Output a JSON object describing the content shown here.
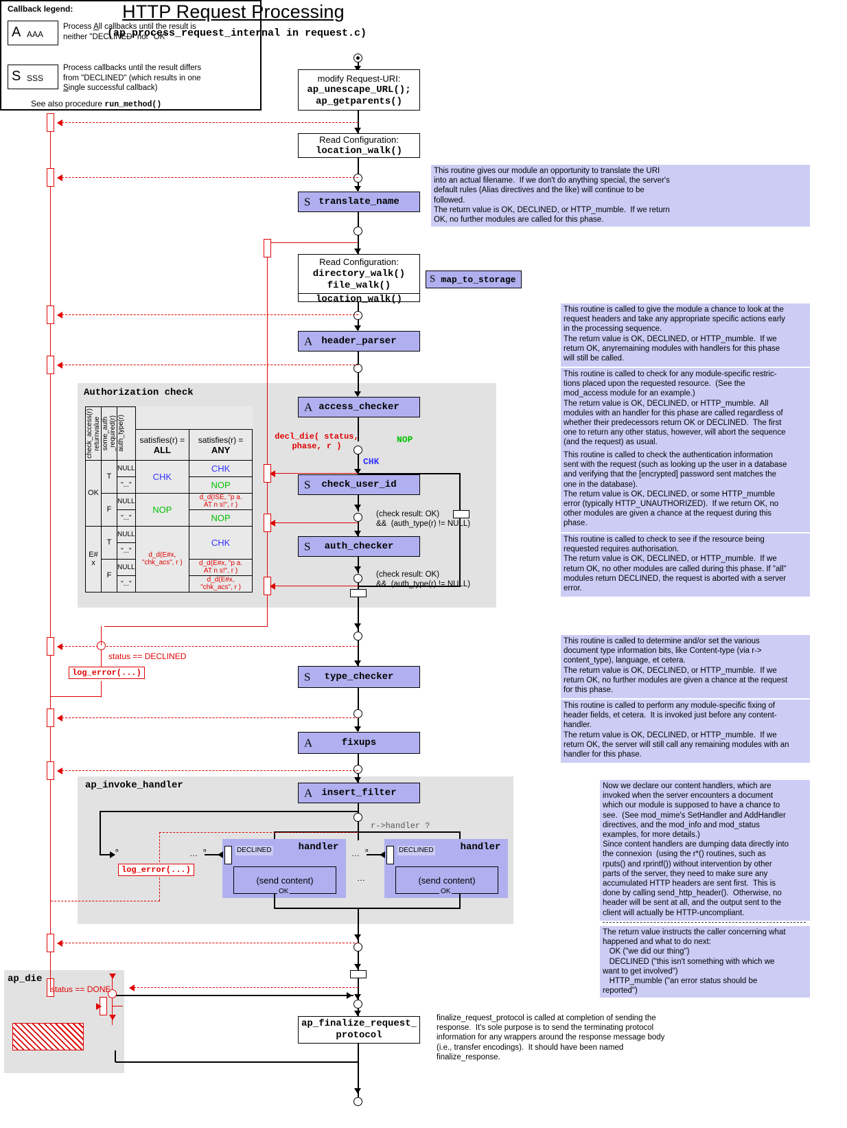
{
  "title": "HTTP Request Processing",
  "subtitle": "(ap_process_request_internal in request.c)",
  "legend": {
    "heading": "Callback legend:",
    "entries": [
      {
        "tag": "A",
        "code": "AAA",
        "desc_l1_a": "Process ",
        "desc_l1_u": "A",
        "desc_l1_b": "ll callbacks until the result is",
        "desc_l2": "neither \"DECLINED\" nor \"OK\""
      },
      {
        "tag": "S",
        "code": "SSS",
        "desc_l1": "Process callbacks until the result differs",
        "desc_l2": "from \"DECLINED\" (which results in one",
        "desc_l3_u": "S",
        "desc_l3_b": "ingle successful callback)"
      }
    ],
    "footer_text": "See also procedure ",
    "footer_mono": "run_method()"
  },
  "flow": {
    "modify_uri": "modify Request-URI:\nap_unescape_URL();\nap_getparents()",
    "read_config_1": "Read Configuration:\nlocation_walk()",
    "translate_name": {
      "tag": "S",
      "label": "translate_name"
    },
    "read_config_2_title": "Read Configuration:",
    "read_config_2_body": "directory_walk()\nfile_walk()",
    "read_config_2_foot": "location_walk()",
    "map_to_storage": {
      "tag": "S",
      "label": "map_to_storage"
    },
    "header_parser": {
      "tag": "A",
      "label": "header_parser"
    },
    "access_checker": {
      "tag": "A",
      "label": "access_checker"
    },
    "check_user_id": {
      "tag": "S",
      "label": "check_user_id"
    },
    "auth_checker": {
      "tag": "S",
      "label": "auth_checker"
    },
    "type_checker": {
      "tag": "S",
      "label": "type_checker"
    },
    "fixups": {
      "tag": "A",
      "label": "fixups"
    },
    "insert_filter": {
      "tag": "A",
      "label": "insert_filter"
    },
    "handler_1": "handler",
    "handler_2": "handler",
    "send_content_1": "(send content)",
    "send_content_2": "(send content)",
    "finalize": "ap_finalize_request_\nprotocol"
  },
  "edge_labels": {
    "decl_die": "decl_die( status,\nphase, r )",
    "nop": "NOP",
    "chk": "CHK",
    "check_result_1": "(check result: OK)\n&& (auth_type(r) != NULL)",
    "check_result_2": "(check result: OK)\n&& (auth_type(r) != NULL)",
    "status_declined": "status == DECLINED",
    "status_done": "status == DONE",
    "log_error_1": "log_error(...)",
    "log_error_2": "log_error(...)",
    "r_handler": "r->handler ?",
    "declined_1": "DECLINED",
    "declined_2": "DECLINED",
    "ok_1": "OK",
    "ok_2": "OK",
    "ellipsis_a": "…",
    "ellipsis_b": "…",
    "ellipsis_c": "…"
  },
  "groups": {
    "authorization_check": "Authorization check",
    "ap_invoke_handler": "ap_invoke_handler",
    "ap_die": "ap_die"
  },
  "auth_table": {
    "col_headers_vertical": [
      "check_access(r)\nreturnvalue",
      "some_auth\n_required(r)",
      "auth_type(r)"
    ],
    "col_headers": [
      "satisfies(r) =\nALL",
      "satisfies(r) =\nANY"
    ],
    "rows": [
      {
        "ret": "OK",
        "auth": "T",
        "type": "NULL",
        "all": "CHK",
        "all_color": "blue",
        "any": "CHK",
        "any_color": "blue"
      },
      {
        "ret": "",
        "auth": "",
        "type": "\"...\"",
        "all": "",
        "all_color": "",
        "any": "NOP",
        "any_color": "green"
      },
      {
        "ret": "",
        "auth": "F",
        "type": "NULL",
        "all": "NOP",
        "all_color": "green",
        "any": "d_d(ISE, \"p a.\nAT n s!\", r )",
        "any_color": "red"
      },
      {
        "ret": "",
        "auth": "",
        "type": "\"...\"",
        "all": "",
        "all_color": "",
        "any": "NOP",
        "any_color": "green"
      },
      {
        "ret": "E#\nx",
        "auth": "T",
        "type": "NULL",
        "all": "d_d(E#x,\n\"chk_acs\", r )",
        "all_color": "red",
        "any": "CHK",
        "any_color": "blue"
      },
      {
        "ret": "",
        "auth": "",
        "type": "\"...\"",
        "all": "",
        "all_color": "",
        "any": "",
        "any_color": ""
      },
      {
        "ret": "",
        "auth": "F",
        "type": "NULL",
        "all": "",
        "all_color": "",
        "any": "d_d(E#x, \"p a.\nAT n s!\", r )",
        "any_color": "red"
      },
      {
        "ret": "",
        "auth": "",
        "type": "\"...\"",
        "all": "",
        "all_color": "",
        "any": "d_d(E#x,\n\"chk_acs\", r )",
        "any_color": "red"
      }
    ]
  },
  "notes": {
    "translate_name": "This routine gives our module an opportunity to translate the URI\ninto an actual filename.  If we don't do anything special, the server's\ndefault rules (Alias directives and the like) will continue to be\nfollowed.\nThe return value is OK, DECLINED, or HTTP_mumble.  If we return\nOK, no further modules are called for this phase.",
    "header_parser": "This routine is called to give the module a chance to look at the\nrequest headers and take any appropriate specific actions early\nin the processing sequence.\nThe return value is OK, DECLINED, or HTTP_mumble.  If we\nreturn OK, anyremaining modules with handlers for this phase\nwill still be called.",
    "access_checker": "This routine is called to check for any module-specific restric-\ntions placed upon the requested resource.  (See the\nmod_access module for an example.)\nThe return value is OK, DECLINED, or HTTP_mumble.  All\nmodules with an handler for this phase are called regardless of\nwhether their predecessors return OK or DECLINED.  The first\none to return any other status, however, will abort the sequence\n(and the request) as usual.",
    "check_user_id": "This routine is called to check the authentication information\nsent with the request (such as looking up the user in a database\nand verifying that the [encrypted] password sent matches the\none in the database).\nThe return value is OK, DECLINED, or some HTTP_mumble\nerror (typically HTTP_UNAUTHORIZED).  If we return OK, no\nother modules are given a chance at the request during this\nphase.",
    "auth_checker": "This routine is called to check to see if the resource being\nrequested requires authorisation.\nThe return value is OK, DECLINED, or HTTP_mumble.  If we\nreturn OK, no other modules are called during this phase. If \"all\"\nmodules return DECLINED, the request is aborted with a server\nerror.",
    "type_checker": "This routine is called to determine and/or set the various\ndocument type information bits, like Content-type (via r->\ncontent_type), language, et cetera.\nThe return value is OK, DECLINED, or HTTP_mumble.  If we\nreturn OK, no further modules are given a chance at the request\nfor this phase.",
    "fixups": "This routine is called to perform any module-specific fixing of\nheader fields, et cetera.  It is invoked just before any content-\nhandler.\nThe return value is OK, DECLINED, or HTTP_mumble.  If we\nreturn OK, the server will still call any remaining modules with an\nhandler for this phase.",
    "handler_a": "Now we declare our content handlers, which are\ninvoked when the server encounters a document\nwhich our module is supposed to have a chance to\nsee.  (See mod_mime's SetHandler and AddHandler\ndirectives, and the mod_info and mod_status\nexamples, for more details.)\nSince content handlers are dumping data directly into\nthe connexion  (using the r*() routines, such as\nrputs() and rprintf()) without intervention by other\nparts of the server, they need to make sure any\naccumulated HTTP headers are sent first.  This is\ndone by calling send_http_header().  Otherwise, no\nheader will be sent at all, and the output sent to the\nclient will actually be HTTP-uncompliant.",
    "handler_b": "The return value instructs the caller concerning what\nhappened and what to do next:\n   OK (\"we did our thing\")\n   DECLINED (\"this isn't something with which we\nwant to get involved\")\n   HTTP_mumble (\"an error status should be\nreported\")",
    "finalize": "finalize_request_protocol is called at completion of sending the\nresponse.  It's sole purpose is to send the terminating protocol\ninformation for any wrappers around the response message body\n(i.e., transfer encodings).  It should have been named\nfinalize_response."
  },
  "colors": {
    "phase_fill": "#b0b0f0",
    "note_fill": "#ccccf5",
    "group_fill": "#e2e2e2",
    "red": "#e00000",
    "green": "#00c000",
    "blue": "#3333ff"
  }
}
